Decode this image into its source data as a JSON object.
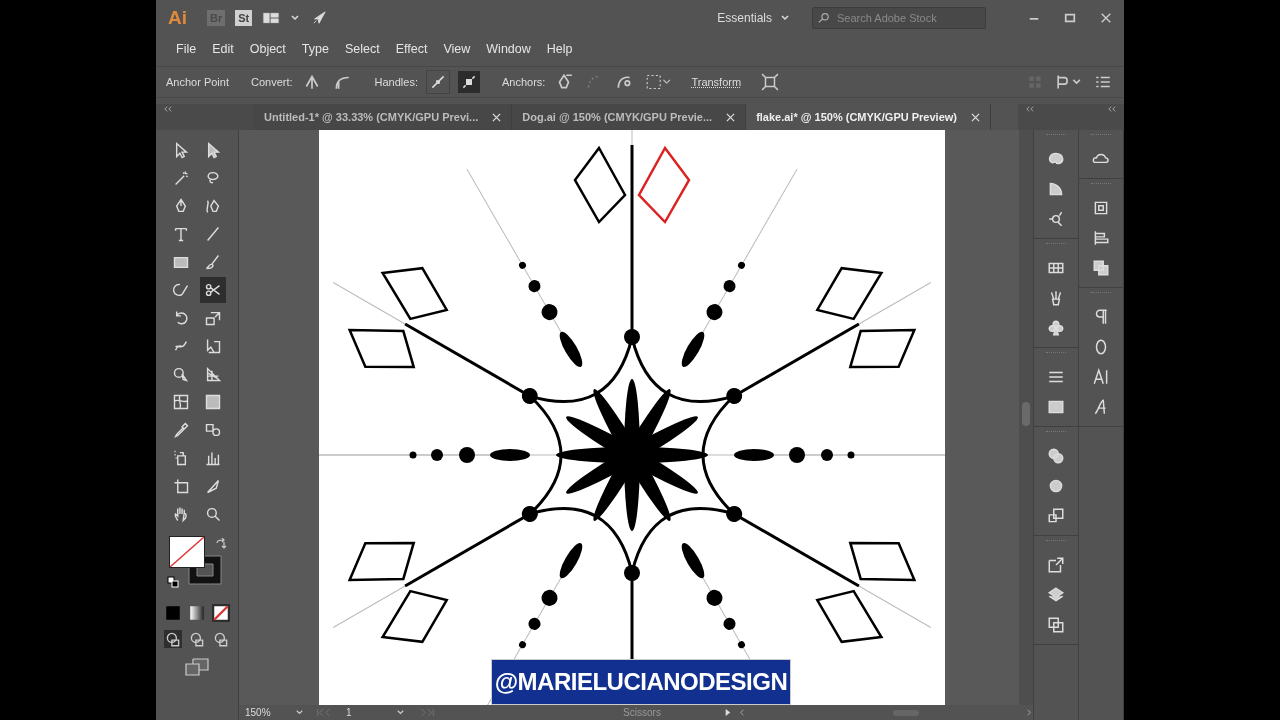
{
  "app": {
    "logo": "Ai",
    "bridge": "Br",
    "stock": "St"
  },
  "workspace": "Essentials",
  "search": {
    "placeholder": "Search Adobe Stock"
  },
  "menu": [
    "File",
    "Edit",
    "Object",
    "Type",
    "Select",
    "Effect",
    "View",
    "Window",
    "Help"
  ],
  "control_bar": {
    "tool_name": "Anchor Point",
    "convert_label": "Convert:",
    "handles_label": "Handles:",
    "anchors_label": "Anchors:",
    "transform": "Transform"
  },
  "tabs": [
    {
      "label": "Untitled-1* @ 33.33% (CMYK/GPU Previ...",
      "selected": false
    },
    {
      "label": "Dog.ai @ 150% (CMYK/GPU Previe...",
      "selected": false
    },
    {
      "label": "flake.ai* @ 150% (CMYK/GPU Preview)",
      "selected": true
    }
  ],
  "tools": [
    {
      "selected": false
    },
    {
      "selected": false
    },
    {
      "selected": false
    },
    {
      "selected": false
    },
    {
      "selected": false
    },
    {
      "selected": false
    },
    {
      "selected": false
    },
    {
      "selected": false
    },
    {
      "selected": false
    },
    {
      "selected": false
    },
    {
      "selected": false
    },
    {
      "selected": true
    },
    {
      "selected": false
    },
    {
      "selected": false
    },
    {
      "selected": false
    },
    {
      "selected": false
    },
    {
      "selected": false
    },
    {
      "selected": false
    },
    {
      "selected": false
    },
    {
      "selected": false
    },
    {
      "selected": false
    },
    {
      "selected": false
    },
    {
      "selected": false
    },
    {
      "selected": false
    },
    {
      "selected": false
    },
    {
      "selected": false
    },
    {
      "selected": false
    },
    {
      "selected": false
    }
  ],
  "draw_modes": [
    {
      "selected": true
    },
    {
      "selected": false
    },
    {
      "selected": false
    }
  ],
  "caption": "@MARIELUCIANODESIGN",
  "status_bar": {
    "zoom": "150%",
    "artboard": "1",
    "tool": "Scissors"
  }
}
